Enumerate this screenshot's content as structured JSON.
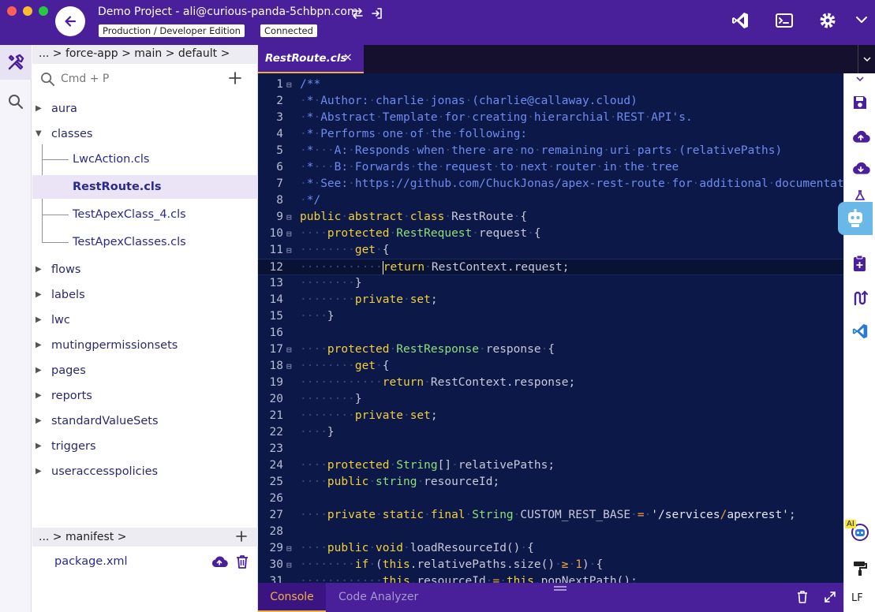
{
  "window": {
    "title": "Demo Project - ali@curious-panda-5chbpn.com",
    "org_type": "Production / Developer Edition",
    "status": "Connected"
  },
  "explorer": {
    "breadcrumb": "... > force-app > main > default >",
    "search_placeholder": "Cmd + P",
    "folders": [
      {
        "label": "aura",
        "expanded": false
      },
      {
        "label": "classes",
        "expanded": true
      },
      {
        "label": "flows",
        "expanded": false
      },
      {
        "label": "labels",
        "expanded": false
      },
      {
        "label": "lwc",
        "expanded": false
      },
      {
        "label": "mutingpermissionsets",
        "expanded": false
      },
      {
        "label": "pages",
        "expanded": false
      },
      {
        "label": "reports",
        "expanded": false
      },
      {
        "label": "standardValueSets",
        "expanded": false
      },
      {
        "label": "triggers",
        "expanded": false
      },
      {
        "label": "useraccesspolicies",
        "expanded": false
      }
    ],
    "class_files": [
      {
        "label": "LwcAction.cls",
        "selected": false
      },
      {
        "label": "RestRoute.cls",
        "selected": true
      },
      {
        "label": "TestApexClass_4.cls",
        "selected": false
      },
      {
        "label": "TestApexClasses.cls",
        "selected": false
      }
    ],
    "manifest_breadcrumb": "... > manifest >",
    "manifest_file": "package.xml"
  },
  "editor": {
    "tab_title": "RestRoute.cls",
    "tab_close": "×",
    "current_line": 12,
    "lines": [
      {
        "n": "1",
        "fold": true,
        "text": "/**"
      },
      {
        "n": "2",
        "fold": false,
        "text": " * Author: charlie jonas (charlie@callaway.cloud)"
      },
      {
        "n": "3",
        "fold": false,
        "text": " * Abstract Template for creating hierarchial REST API's."
      },
      {
        "n": "4",
        "fold": false,
        "text": " * Performs one of the following:"
      },
      {
        "n": "5",
        "fold": false,
        "text": " *   A: Responds when there are no remaining uri parts (relativePaths)"
      },
      {
        "n": "6",
        "fold": false,
        "text": " *   B: Forwards the request to next router in the tree"
      },
      {
        "n": "7",
        "fold": false,
        "text": " * See: https://github.com/ChuckJonas/apex-rest-route for additional documentation"
      },
      {
        "n": "8",
        "fold": false,
        "text": " */"
      },
      {
        "n": "9",
        "fold": true,
        "text": "public abstract class RestRoute {"
      },
      {
        "n": "10",
        "fold": true,
        "text": "    protected RestRequest request {"
      },
      {
        "n": "11",
        "fold": true,
        "text": "        get {"
      },
      {
        "n": "12",
        "fold": false,
        "text": "            return RestContext.request;"
      },
      {
        "n": "13",
        "fold": false,
        "text": "        }"
      },
      {
        "n": "14",
        "fold": false,
        "text": "        private set;"
      },
      {
        "n": "15",
        "fold": false,
        "text": "    }"
      },
      {
        "n": "16",
        "fold": false,
        "text": ""
      },
      {
        "n": "17",
        "fold": true,
        "text": "    protected RestResponse response {"
      },
      {
        "n": "18",
        "fold": true,
        "text": "        get {"
      },
      {
        "n": "19",
        "fold": false,
        "text": "            return RestContext.response;"
      },
      {
        "n": "20",
        "fold": false,
        "text": "        }"
      },
      {
        "n": "21",
        "fold": false,
        "text": "        private set;"
      },
      {
        "n": "22",
        "fold": false,
        "text": "    }"
      },
      {
        "n": "23",
        "fold": false,
        "text": ""
      },
      {
        "n": "24",
        "fold": false,
        "text": "    protected String[] relativePaths;"
      },
      {
        "n": "25",
        "fold": false,
        "text": "    public string resourceId;"
      },
      {
        "n": "26",
        "fold": false,
        "text": ""
      },
      {
        "n": "27",
        "fold": false,
        "text": "    private static final String CUSTOM_REST_BASE = '/services/apexrest';"
      },
      {
        "n": "28",
        "fold": false,
        "text": ""
      },
      {
        "n": "29",
        "fold": true,
        "text": "    public void loadResourceId() {"
      },
      {
        "n": "30",
        "fold": true,
        "text": "        if (this.relativePaths.size() ≥ 1) {"
      },
      {
        "n": "31",
        "fold": false,
        "text": "            this.resourceId = this.popNextPath();"
      }
    ]
  },
  "bottom_panel": {
    "tabs": [
      "Console",
      "Code Analyzer"
    ],
    "active_tab": "Console"
  },
  "rightbar": {
    "ai_badge": "AI",
    "line_ending": "LF"
  },
  "colors": {
    "brand_purple": "#4a1f9a",
    "editor_bg": "#0c1847",
    "accent_orange": "#f0b040",
    "comment_blue": "#6e8cf0",
    "keyword_yellow": "#f2d03a",
    "type_green": "#8fe07a"
  },
  "icons": {
    "back": "arrow-left-icon",
    "switch_org": "swap-arrows-icon",
    "login": "login-icon",
    "vscode": "vscode-icon",
    "terminal": "terminal-icon",
    "settings": "gear-icon",
    "menu": "chevron-down-icon"
  }
}
